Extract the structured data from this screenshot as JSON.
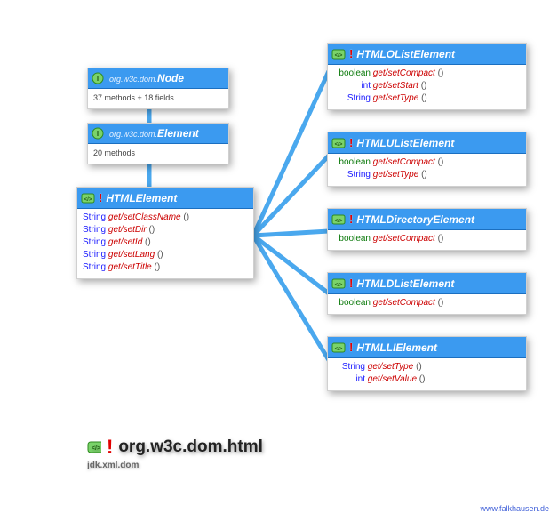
{
  "title": {
    "bang": "!",
    "main": "org.w3c.dom.html",
    "sub": "jdk.xml.dom"
  },
  "footer": "www.falkhausen.de",
  "node": {
    "pkg": "org.w3c.dom.",
    "name": "Node",
    "summary": "37 methods + 18 fields"
  },
  "element": {
    "pkg": "org.w3c.dom.",
    "name": "Element",
    "summary": "20 methods"
  },
  "htmlElement": {
    "bang": "!",
    "name": "HTMLElement",
    "methods": [
      {
        "ret": "String",
        "get": "get",
        "sep": "/",
        "set": "set",
        "prop": "ClassName",
        "p": "()"
      },
      {
        "ret": "String",
        "get": "get",
        "sep": "/",
        "set": "set",
        "prop": "Dir",
        "p": "()"
      },
      {
        "ret": "String",
        "get": "get",
        "sep": "/",
        "set": "set",
        "prop": "Id",
        "p": "()"
      },
      {
        "ret": "String",
        "get": "get",
        "sep": "/",
        "set": "set",
        "prop": "Lang",
        "p": "()"
      },
      {
        "ret": "String",
        "get": "get",
        "sep": "/",
        "set": "set",
        "prop": "Title",
        "p": "()"
      }
    ]
  },
  "olist": {
    "bang": "!",
    "name": "HTMLOListElement",
    "methods": [
      {
        "ret": "boolean",
        "get": "get",
        "sep": "/",
        "set": "set",
        "prop": "Compact",
        "p": "()"
      },
      {
        "ret": "int",
        "get": "get",
        "sep": "/",
        "set": "set",
        "prop": "Start",
        "p": "()"
      },
      {
        "ret": "String",
        "get": "get",
        "sep": "/",
        "set": "set",
        "prop": "Type",
        "p": "()"
      }
    ]
  },
  "ulist": {
    "bang": "!",
    "name": "HTMLUListElement",
    "methods": [
      {
        "ret": "boolean",
        "get": "get",
        "sep": "/",
        "set": "set",
        "prop": "Compact",
        "p": "()"
      },
      {
        "ret": "String",
        "get": "get",
        "sep": "/",
        "set": "set",
        "prop": "Type",
        "p": "()"
      }
    ]
  },
  "dir": {
    "bang": "!",
    "name": "HTMLDirectoryElement",
    "methods": [
      {
        "ret": "boolean",
        "get": "get",
        "sep": "/",
        "set": "set",
        "prop": "Compact",
        "p": "()"
      }
    ]
  },
  "dlist": {
    "bang": "!",
    "name": "HTMLDListElement",
    "methods": [
      {
        "ret": "boolean",
        "get": "get",
        "sep": "/",
        "set": "set",
        "prop": "Compact",
        "p": "()"
      }
    ]
  },
  "li": {
    "bang": "!",
    "name": "HTMLLIElement",
    "methods": [
      {
        "ret": "String",
        "get": "get",
        "sep": "/",
        "set": "set",
        "prop": "Type",
        "p": "()"
      },
      {
        "ret": "int",
        "get": "get",
        "sep": "/",
        "set": "set",
        "prop": "Value",
        "p": "()"
      }
    ]
  }
}
